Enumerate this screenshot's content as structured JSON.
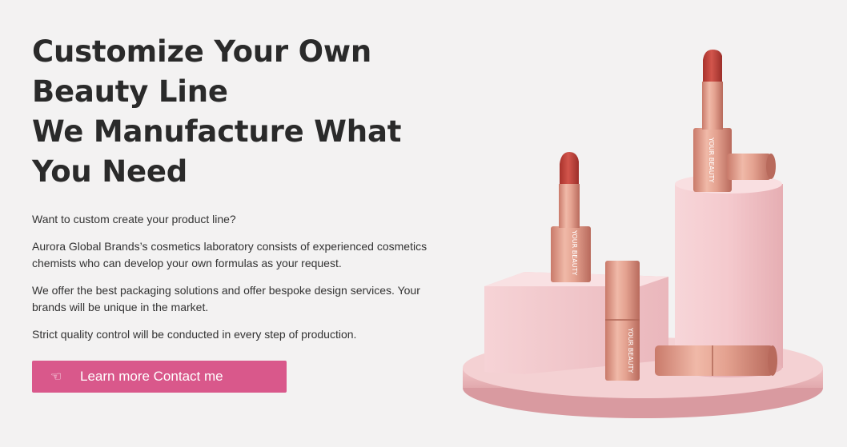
{
  "hero": {
    "headline": [
      "Customize Your Own",
      "Beauty Line",
      "We Manufacture What",
      "You Need"
    ],
    "paragraphs": [
      "Want to custom create your product line?",
      "Aurora Global Brands’s cosmetics laboratory consists of experienced cosmetics chemists who can develop your own formulas as your request.",
      "We offer the best packaging solutions and offer bespoke design services. Your brands will be unique in the market.",
      "Strict quality control will be conducted in every step of production."
    ],
    "cta_label": "Learn more Contact me",
    "cta_icon": "hand-pointing-icon"
  },
  "image": {
    "tube_text": "YOUR BEAUTY",
    "colors": {
      "background": "#f3f2f2",
      "button": "#d9588b",
      "pink_block": "#f4ccd0",
      "rose_gold": "#d99586",
      "lipstick_red": "#c0473f"
    }
  }
}
